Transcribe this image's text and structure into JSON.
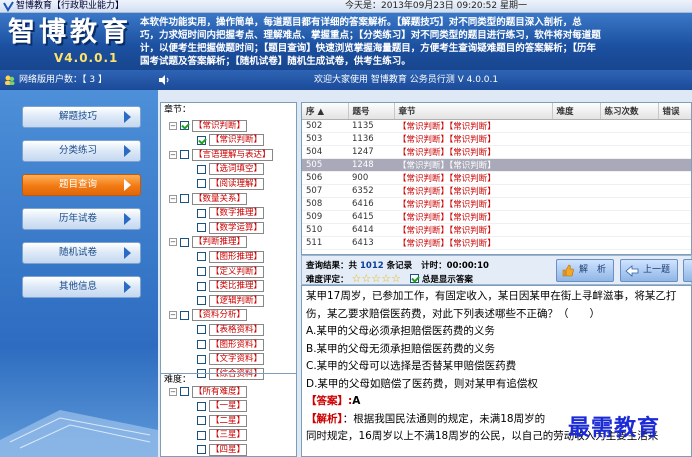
{
  "window": {
    "title": "智博教育【行政职业能力】",
    "date_text": "今天是：2013年09月23日   09:20:52   星期一"
  },
  "header": {
    "logo_text": "智博教育",
    "version": "V4.0.0.1",
    "intro_lines": [
      "本软件功能实用，操作简单，每道题目都有详细的答案解析。【解题技巧】对不同类型的题目深入剖析，总",
      "巧，力求短时间内把握考点、理解难点、掌握重点；【分类练习】对不同类型的题目进行练习，软件将对每道题",
      "计，以便考生把握做题时间；【题目查询】快速浏览掌握海量题目，方便考生查询疑难题目的答案解析；【历年",
      "国考试题及答案解析；【随机试卷】随机生成试卷，供考生练习。"
    ]
  },
  "statusbar": {
    "online_users": "网络版用户数：【 3 】",
    "welcome": "欢迎大家使用 智博教育 公务员行测 V 4.0.0.1"
  },
  "nav": {
    "items": [
      {
        "label": "解题技巧",
        "active": false
      },
      {
        "label": "分类练习",
        "active": false
      },
      {
        "label": "题目查询",
        "active": true
      },
      {
        "label": "历年试卷",
        "active": false
      },
      {
        "label": "随机试卷",
        "active": false
      },
      {
        "label": "其他信息",
        "active": false
      }
    ]
  },
  "tree": {
    "header": "章节：",
    "nodes": [
      {
        "level": 0,
        "expander": "−",
        "checked": true,
        "label": "【常识判断】"
      },
      {
        "level": 1,
        "checked": true,
        "label": "【常识判断】"
      },
      {
        "level": 0,
        "expander": "−",
        "checked": false,
        "label": "【言语理解与表达】"
      },
      {
        "level": 1,
        "checked": false,
        "label": "【选词填空】"
      },
      {
        "level": 1,
        "checked": false,
        "label": "【阅读理解】"
      },
      {
        "level": 0,
        "expander": "−",
        "checked": false,
        "label": "【数量关系】"
      },
      {
        "level": 1,
        "checked": false,
        "label": "【数字推理】"
      },
      {
        "level": 1,
        "checked": false,
        "label": "【数学运算】"
      },
      {
        "level": 0,
        "expander": "−",
        "checked": false,
        "label": "【判断推理】"
      },
      {
        "level": 1,
        "checked": false,
        "label": "【图形推理】"
      },
      {
        "level": 1,
        "checked": false,
        "label": "【定义判断】"
      },
      {
        "level": 1,
        "checked": false,
        "label": "【类比推理】"
      },
      {
        "level": 1,
        "checked": false,
        "label": "【逻辑判断】"
      },
      {
        "level": 0,
        "expander": "−",
        "checked": false,
        "label": "【资料分析】"
      },
      {
        "level": 1,
        "checked": false,
        "label": "【表格资料】"
      },
      {
        "level": 1,
        "checked": false,
        "label": "【图形资料】"
      },
      {
        "level": 1,
        "checked": false,
        "label": "【文字资料】"
      },
      {
        "level": 1,
        "checked": false,
        "label": "【综合资料】"
      }
    ],
    "difficulty_header": "难度：",
    "difficulty_nodes": [
      {
        "level": 0,
        "expander": "−",
        "checked": false,
        "label": "【所有难度】"
      },
      {
        "level": 1,
        "checked": false,
        "label": "【一星】"
      },
      {
        "level": 1,
        "checked": false,
        "label": "【二星】"
      },
      {
        "level": 1,
        "checked": false,
        "label": "【三星】"
      },
      {
        "level": 1,
        "checked": false,
        "label": "【四星】"
      },
      {
        "level": 1,
        "checked": false,
        "label": "【五星】"
      }
    ]
  },
  "grid": {
    "columns": [
      "序 ▲",
      "题号",
      "章节",
      "难度",
      "练习次数",
      "错误"
    ],
    "rows": [
      {
        "seq": "502",
        "num": "1135",
        "chapter": "【常识判断】【常识判断】",
        "selected": false
      },
      {
        "seq": "503",
        "num": "1136",
        "chapter": "【常识判断】【常识判断】",
        "selected": false
      },
      {
        "seq": "504",
        "num": "1247",
        "chapter": "【常识判断】【常识判断】",
        "selected": false
      },
      {
        "seq": "505",
        "num": "1248",
        "chapter": "【常识判断】【常识判断】",
        "selected": true
      },
      {
        "seq": "506",
        "num": "900",
        "chapter": "【常识判断】【常识判断】",
        "selected": false
      },
      {
        "seq": "507",
        "num": "6352",
        "chapter": "【常识判断】【常识判断】",
        "selected": false
      },
      {
        "seq": "508",
        "num": "6416",
        "chapter": "【常识判断】【常识判断】",
        "selected": false
      },
      {
        "seq": "509",
        "num": "6415",
        "chapter": "【常识判断】【常识判断】",
        "selected": false
      },
      {
        "seq": "510",
        "num": "6414",
        "chapter": "【常识判断】【常识判断】",
        "selected": false
      },
      {
        "seq": "511",
        "num": "6413",
        "chapter": "【常识判断】【常识判断】",
        "selected": false
      }
    ]
  },
  "search": {
    "result_prefix": "查询结果：共",
    "result_count": "1012",
    "result_suffix": "条记录",
    "timer_label": "计时：",
    "timer_value": "00:00:10",
    "difficulty_label": "难度评定：",
    "stars": "☆☆☆☆☆",
    "show_answer_label": "总是显示答案",
    "show_answer_checked": true,
    "analyze_label": "解　析",
    "prev_label": "上一题"
  },
  "question": {
    "stem": "某甲17周岁，已参加工作，有固定收入，某日因某甲在街上寻衅滋事，将某乙打伤，某乙要求赔偿医药费，对此下列表述哪些不正确？（　　）",
    "options": [
      "A.某甲的父母必须承担赔偿医药费的义务",
      "B.某甲的父母无须承担赔偿医药费的义务",
      "C.某甲的父母可以选择是否替某甲赔偿医药费",
      "D.某甲的父母如赔偿了医药费，则对某甲有追偿权"
    ],
    "answer_label": "【答案】:",
    "answer_value": "A",
    "analysis_label": "【解析】",
    "analysis_lines": [
      "：根据我国民法通则的规定，未满18周岁的",
      "同时规定，16周岁以上不满18周岁的公民，以自己的劳动收入为主要生活来"
    ]
  },
  "watermark": "最需教育",
  "colors": {
    "header_blue": "#1b4f9f",
    "nav_blue": "#2d6cc0",
    "active_orange": "#f27a12",
    "selected_row": "#a9a9b9",
    "label_red": "#cc0000"
  }
}
